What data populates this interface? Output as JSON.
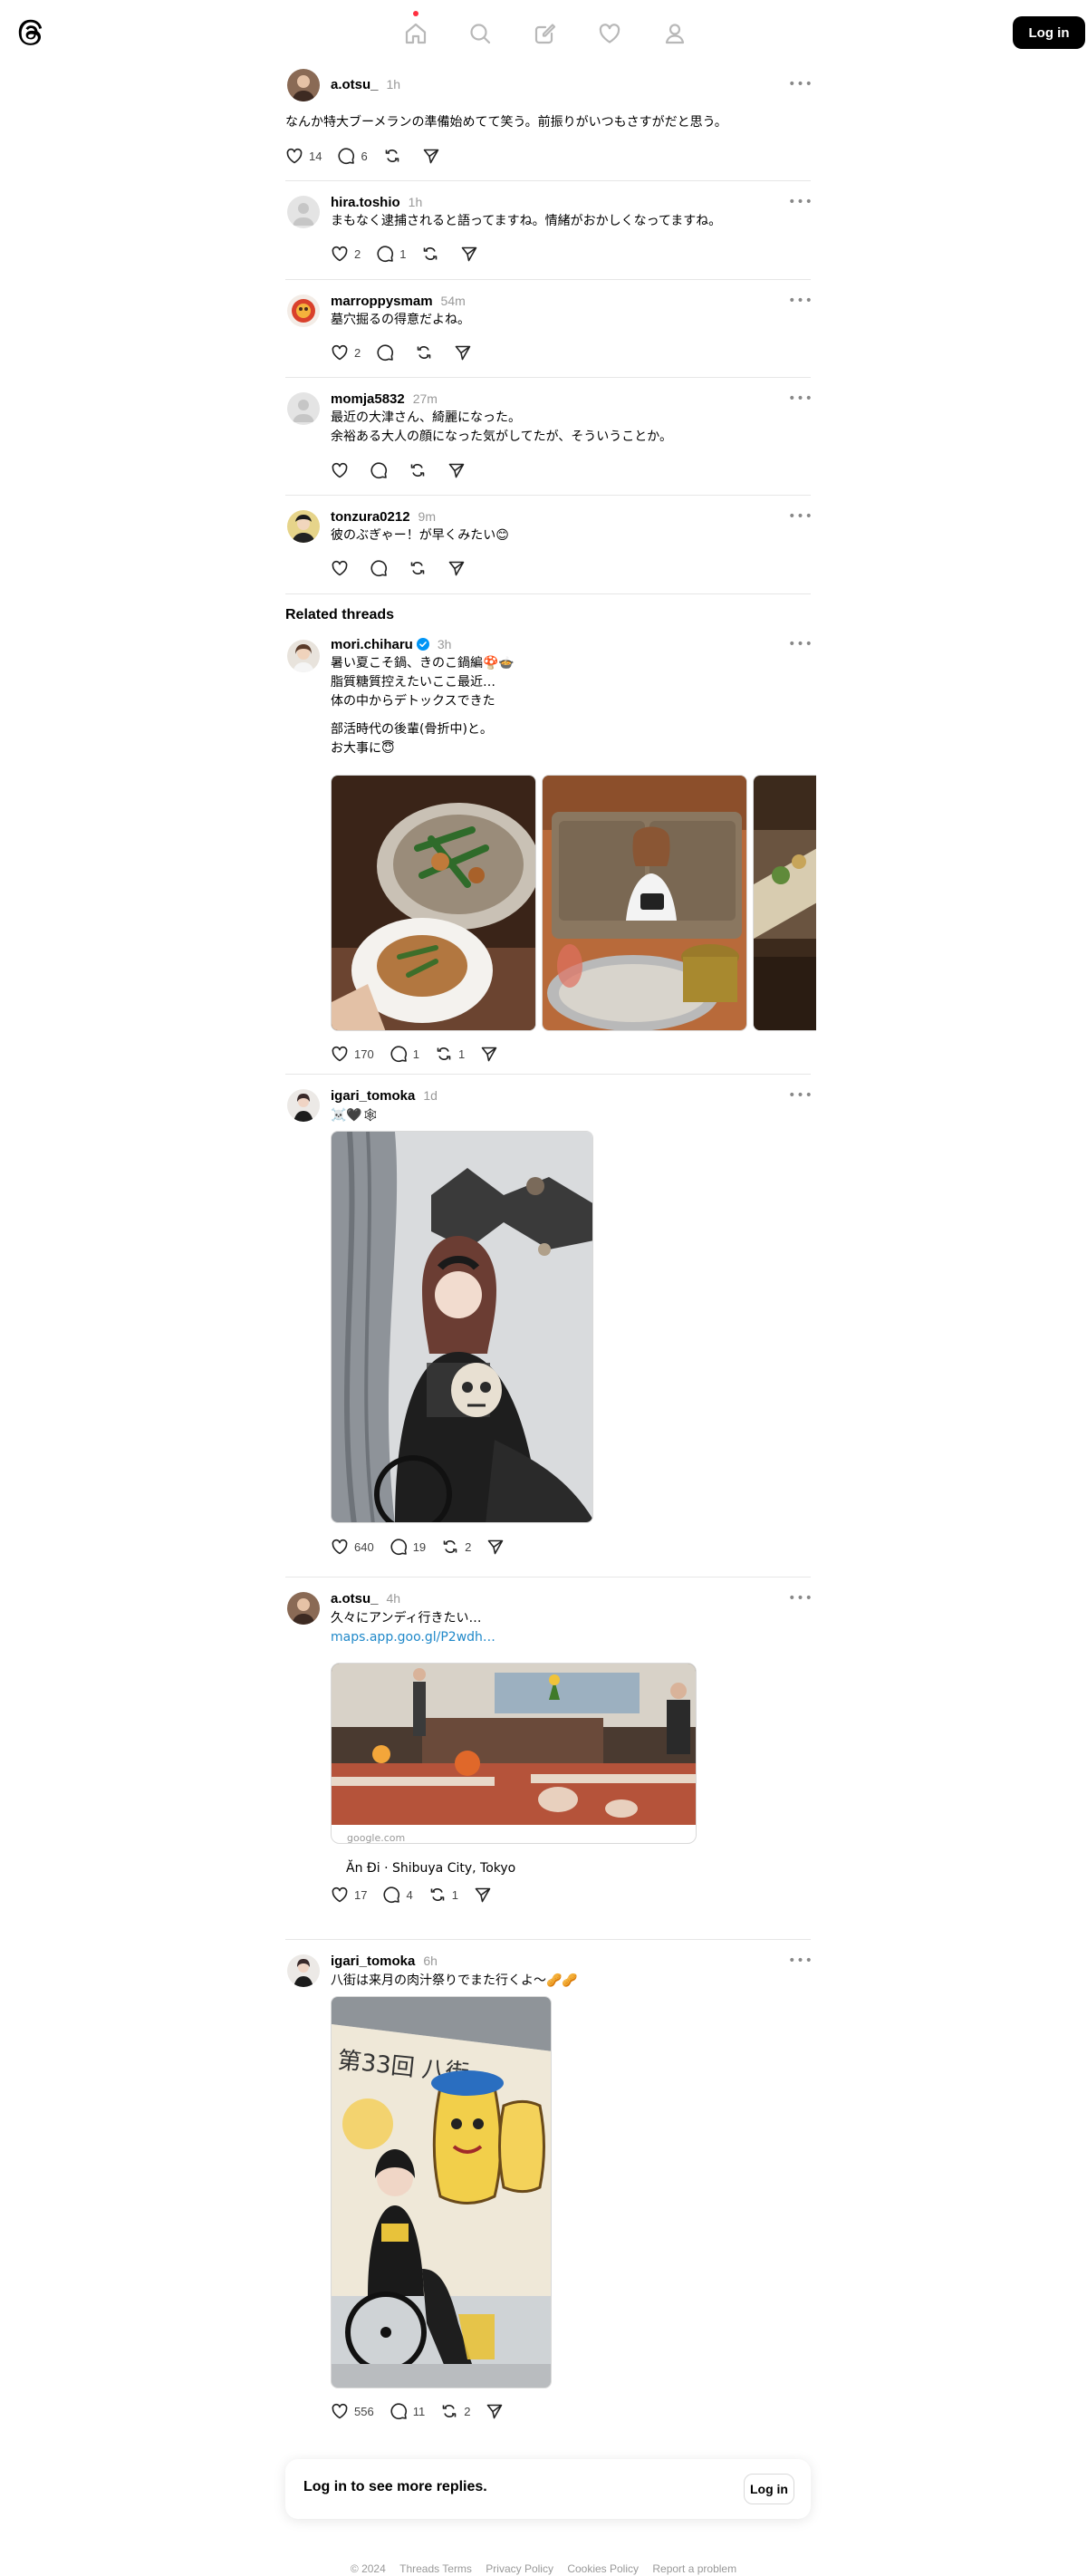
{
  "header": {
    "login_label": "Log in",
    "nav": [
      {
        "icon": "home-icon",
        "active": true
      },
      {
        "icon": "search-icon"
      },
      {
        "icon": "compose-icon"
      },
      {
        "icon": "heart-icon"
      },
      {
        "icon": "profile-icon"
      }
    ]
  },
  "replies": [
    {
      "username": "a.otsu_",
      "time": "1h",
      "lines": [
        "なんか特大ブーメランの準備始めてて笑う。前振りがいつもさすがだと思う。"
      ],
      "likes": "14",
      "comments": "6",
      "reposts": "",
      "shares": ""
    },
    {
      "username": "hira.toshio",
      "time": "1h",
      "lines": [
        "まもなく逮捕されると語ってますね。情緒がおかしくなってますね。"
      ],
      "likes": "2",
      "comments": "1",
      "reposts": "",
      "shares": ""
    },
    {
      "username": "marroppysmam",
      "time": "54m",
      "lines": [
        "墓穴掘るの得意だよね。"
      ],
      "likes": "2",
      "comments": "",
      "reposts": "",
      "shares": ""
    },
    {
      "username": "momja5832",
      "time": "27m",
      "lines": [
        "最近の大津さん、綺麗になった。",
        "余裕ある大人の顔になった気がしてたが、そういうことか。"
      ],
      "likes": "",
      "comments": "",
      "reposts": "",
      "shares": ""
    },
    {
      "username": "tonzura0212",
      "time": "9m",
      "lines": [
        "彼のぶぎゃー！が早くみたい😊"
      ],
      "likes": "",
      "comments": "",
      "reposts": "",
      "shares": ""
    }
  ],
  "related": {
    "title": "Related threads",
    "threads": [
      {
        "username": "mori.chiharu",
        "verified": true,
        "time": "3h",
        "lines": [
          "暑い夏こそ鍋、きのこ鍋編🍄🍲",
          "脂質糖質控えたいここ最近…",
          "体の中からデトックスできた",
          "",
          "部活時代の後輩(骨折中)と。",
          "お大事に😇"
        ],
        "likes": "170",
        "comments": "1",
        "reposts": "1",
        "shares": ""
      },
      {
        "username": "igari_tomoka",
        "verified": false,
        "time": "1d",
        "lines": [
          "☠️🖤🕸"
        ],
        "likes": "640",
        "comments": "19",
        "reposts": "2",
        "shares": ""
      },
      {
        "username": "a.otsu_",
        "verified": false,
        "time": "4h",
        "lines": [
          "久々にアンディ行きたい…"
        ],
        "link": "maps.app.goo.gl/P2wdh…",
        "card": {
          "domain": "google.com",
          "title": "Ăn Đi · Shibuya City, Tokyo"
        },
        "likes": "17",
        "comments": "4",
        "reposts": "1",
        "shares": ""
      },
      {
        "username": "igari_tomoka",
        "verified": false,
        "time": "6h",
        "lines": [
          "八街は来月の肉汁祭りでまた行くよ〜🥜🥜"
        ],
        "likes": "556",
        "comments": "11",
        "reposts": "2",
        "shares": ""
      }
    ]
  },
  "more_replies": {
    "text": "Log in to see more replies.",
    "login_label": "Log in"
  },
  "footer": {
    "items": [
      "© 2024",
      "Threads Terms",
      "Privacy Policy",
      "Cookies Policy",
      "Report a problem"
    ]
  },
  "colors": {
    "accent_link": "#1f88c9",
    "notification_dot": "#ff3040",
    "verified": "#0095f6"
  }
}
